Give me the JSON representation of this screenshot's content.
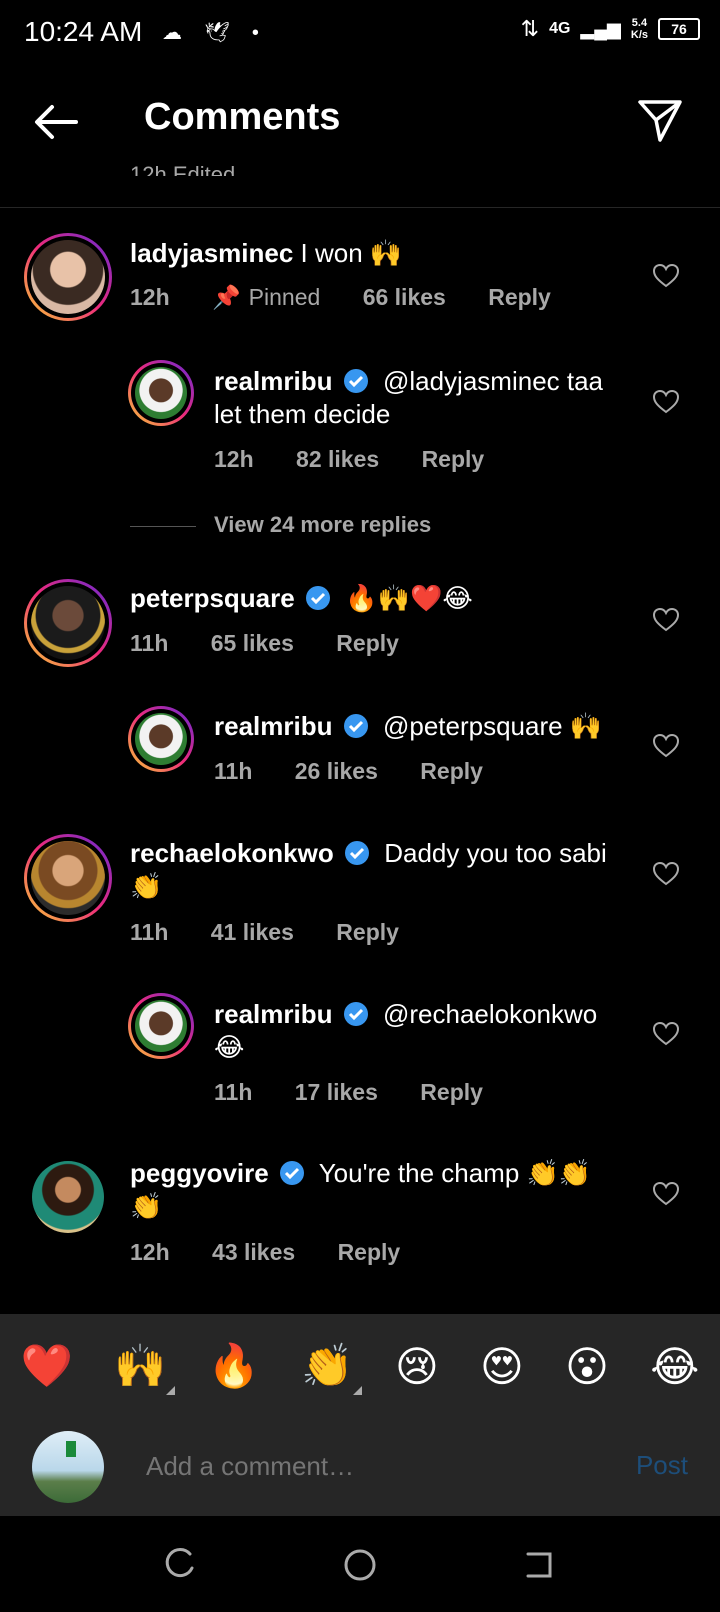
{
  "status_bar": {
    "time": "10:24 AM",
    "left_icons": [
      "cloud-icon",
      "bird-icon",
      "dot-icon"
    ],
    "network": "4G",
    "speed_value": "5.4",
    "speed_unit": "K/s",
    "battery": "76"
  },
  "header": {
    "title": "Comments",
    "back_icon": "back-arrow-icon",
    "share_icon": "send-icon",
    "cutoff_text": "12h Edited"
  },
  "comments": [
    {
      "username": "ladyjasminec",
      "verified": false,
      "text": "I won 🙌",
      "time": "12h",
      "pinned": "Pinned",
      "likes": "66 likes",
      "reply": "Reply",
      "is_reply": false
    },
    {
      "username": "realmribu",
      "verified": true,
      "text": "@ladyjasminec taa let them decide",
      "time": "12h",
      "likes": "82 likes",
      "reply": "Reply",
      "is_reply": true
    },
    {
      "username": "peterpsquare",
      "verified": true,
      "text": "🔥🙌❤️😂",
      "time": "11h",
      "likes": "65 likes",
      "reply": "Reply",
      "is_reply": false
    },
    {
      "username": "realmribu",
      "verified": true,
      "text": "@peterpsquare 🙌",
      "time": "11h",
      "likes": "26 likes",
      "reply": "Reply",
      "is_reply": true
    },
    {
      "username": "rechaelokonkwo",
      "verified": true,
      "text": "Daddy you too sabi 👏",
      "time": "11h",
      "likes": "41 likes",
      "reply": "Reply",
      "is_reply": false
    },
    {
      "username": "realmribu",
      "verified": true,
      "text": "@rechaelokonkwo 😂",
      "time": "11h",
      "likes": "17 likes",
      "reply": "Reply",
      "is_reply": true
    },
    {
      "username": "peggyovire",
      "verified": true,
      "text": "You're the champ 👏👏👏",
      "time": "12h",
      "likes": "43 likes",
      "reply": "Reply",
      "is_reply": false
    }
  ],
  "view_more": "View 24 more replies",
  "emoji_bar": [
    "❤️",
    "🙌",
    "🔥",
    "👏",
    "😢",
    "😍",
    "😮",
    "😂"
  ],
  "composer": {
    "placeholder": "Add a comment…",
    "post_label": "Post"
  },
  "nav": [
    "recents-icon",
    "home-icon",
    "back-icon"
  ],
  "colors": {
    "background": "#000000",
    "secondary_text": "#a8a8a8",
    "verified_blue": "#3897f0",
    "post_disabled": "#1d4e7a",
    "panel": "#262626"
  }
}
